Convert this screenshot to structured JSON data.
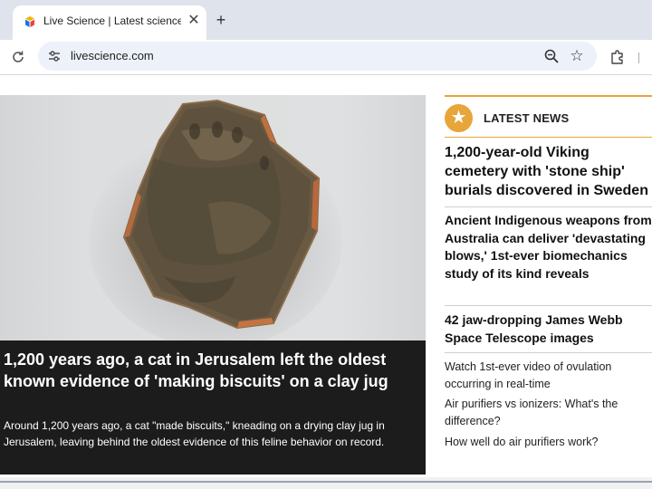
{
  "browser": {
    "tab": {
      "title": "Live Science | Latest science"
    },
    "toolbar": {
      "url": "livescience.com"
    },
    "icons": {
      "favicon": "live-science-favicon",
      "close": "close-icon",
      "new_tab": "plus-icon",
      "reload": "reload-icon",
      "site_info": "tune-icon",
      "zoom": "zoom-icon",
      "bookmark": "star-icon",
      "extensions": "puzzle-icon"
    }
  },
  "hero": {
    "title": "1,200 years ago, a cat in Jerusalem left the oldest known evidence of 'making biscuits' on a clay jug",
    "summary": "Around 1,200 years ago, a cat \"made biscuits,\" kneading on a drying clay jug in Jerusalem, leaving behind the oldest evidence of this feline behavior on record."
  },
  "sidebar": {
    "heading": "LATEST NEWS",
    "accent_color": "#e8a53a",
    "items": [
      {
        "title": "1,200-year-old Viking cemetery with 'stone ship' burials discovered in Sweden"
      },
      {
        "title": "Ancient Indigenous weapons from Australia can deliver 'devastating blows,' 1st-ever biomechanics study of its kind reveals"
      },
      {
        "title": "42 jaw-dropping James Webb Space Telescope images"
      },
      {
        "title": "Watch 1st-ever video of ovulation occurring in real-time"
      },
      {
        "title": "Air purifiers vs ionizers: What's the difference?"
      },
      {
        "title": "How well do air purifiers work?"
      }
    ]
  }
}
